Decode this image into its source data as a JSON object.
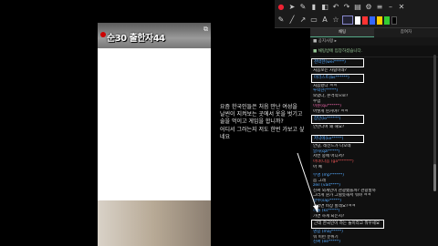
{
  "video": {
    "caption": "순30 출한자44",
    "corner_icon": "⧉"
  },
  "overlay_text": "요즘 한국인들은 처음 만난 여성을\n날씬이 지켜보는 곳에서 옷을 벗기고\n술을 먹이고 게임을 합니까?\n어디서 그러는지 저도 한번 가보고 싶\n네요",
  "toolbar": {
    "row1_icons": [
      "record-icon",
      "cursor-icon",
      "pen-icon",
      "highlighter-icon",
      "eraser-icon",
      "undo-icon",
      "redo-icon",
      "trash-icon",
      "settings-icon",
      "menu-icon",
      "minimize-icon",
      "close-icon"
    ],
    "row2_icons": [
      "pen-tool-icon",
      "line-icon",
      "arrow-icon",
      "rectangle-icon",
      "text-icon",
      "shape-icon"
    ],
    "colors": [
      "#ffffff",
      "#ff3333",
      "#3366ff",
      "#ffcc00",
      "#33cc33",
      "#000000"
    ]
  },
  "chat": {
    "tabs": [
      "채팅",
      "참여자"
    ],
    "header": "■ 공지사항 ▸",
    "notice": "■ 채팅방에 입장하셨습니다.",
    "messages": [
      {
        "nick": "천박한(wei*****)",
        "text": "",
        "style": "boxed"
      },
      {
        "nick": "",
        "text": "처음보는 사람이네?",
        "style": ""
      },
      {
        "nick": "마라스트(bs******)",
        "text": "",
        "style": "boxed"
      },
      {
        "nick": "",
        "text": "처음봤다 ㅋㅋ",
        "style": ""
      },
      {
        "nick": "투박한(*****)",
        "text": "",
        "style": ""
      },
      {
        "nick": "",
        "text": "보였다, 본격적으로?",
        "style": ""
      },
      {
        "nick": "",
        "text": "수업",
        "style": ""
      },
      {
        "nick": "이준(qu******)",
        "text": "",
        "style": "pink"
      },
      {
        "nick": "",
        "text": "어떻게 된거야? ㅋㅋ",
        "style": ""
      },
      {
        "nick": "잡던(lo******)",
        "text": "",
        "style": "boxed"
      },
      {
        "nick": "",
        "text": "안한다며 왜 해요?",
        "style": ""
      },
      {
        "nick": "",
        "text": "",
        "style": "gap"
      },
      {
        "nick": "저녁에(ke*****)",
        "text": "",
        "style": "boxed"
      },
      {
        "nick": "",
        "text": "안녕, 레전드가 나오네",
        "style": ""
      },
      {
        "nick": "달자(qzl*****)",
        "text": "",
        "style": ""
      },
      {
        "nick": "",
        "text": "저번 중에 어디서?",
        "style": ""
      },
      {
        "nick": "마녀(다음 (ga*******)",
        "text": "",
        "style": "red"
      },
      {
        "nick": "",
        "text": "아 예",
        "style": ""
      },
      {
        "nick": "",
        "text": "",
        "style": "gap"
      },
      {
        "nick": "무명 (mp******)",
        "text": "",
        "style": ""
      },
      {
        "nick": "",
        "text": "음 그래",
        "style": ""
      },
      {
        "nick": "zeil (vait****)",
        "text": "",
        "style": ""
      },
      {
        "nick": "",
        "text": "진짜 외계인이 관광했을까? 관광할까",
        "style": ""
      },
      {
        "nick": "",
        "text": "그러게 뭔가 그럴듯해서 뭐야 ㅋㅋ",
        "style": ""
      },
      {
        "nick": "알수(sap*****)",
        "text": "",
        "style": ""
      },
      {
        "nick": "",
        "text": "그러면 비상 할래요?ㅋㅋ",
        "style": ""
      },
      {
        "nick": "하늘 (ks*****)",
        "text": "",
        "style": ""
      },
      {
        "nick": "",
        "text": "가면 하게 되는지?",
        "style": ""
      },
      {
        "nick": "",
        "text": "근데 한국인이 하는 놀이라고 뭐우세요",
        "style": "boxed wide"
      },
      {
        "nick": "명함 (maj*****)",
        "text": "",
        "style": ""
      },
      {
        "nick": "",
        "text": "뭐 이런 분위기",
        "style": ""
      },
      {
        "nick": "진짜 (ee*****)",
        "text": "",
        "style": ""
      }
    ]
  },
  "colors": {
    "accent": "#55aaff",
    "annotation": "#ffffff"
  }
}
